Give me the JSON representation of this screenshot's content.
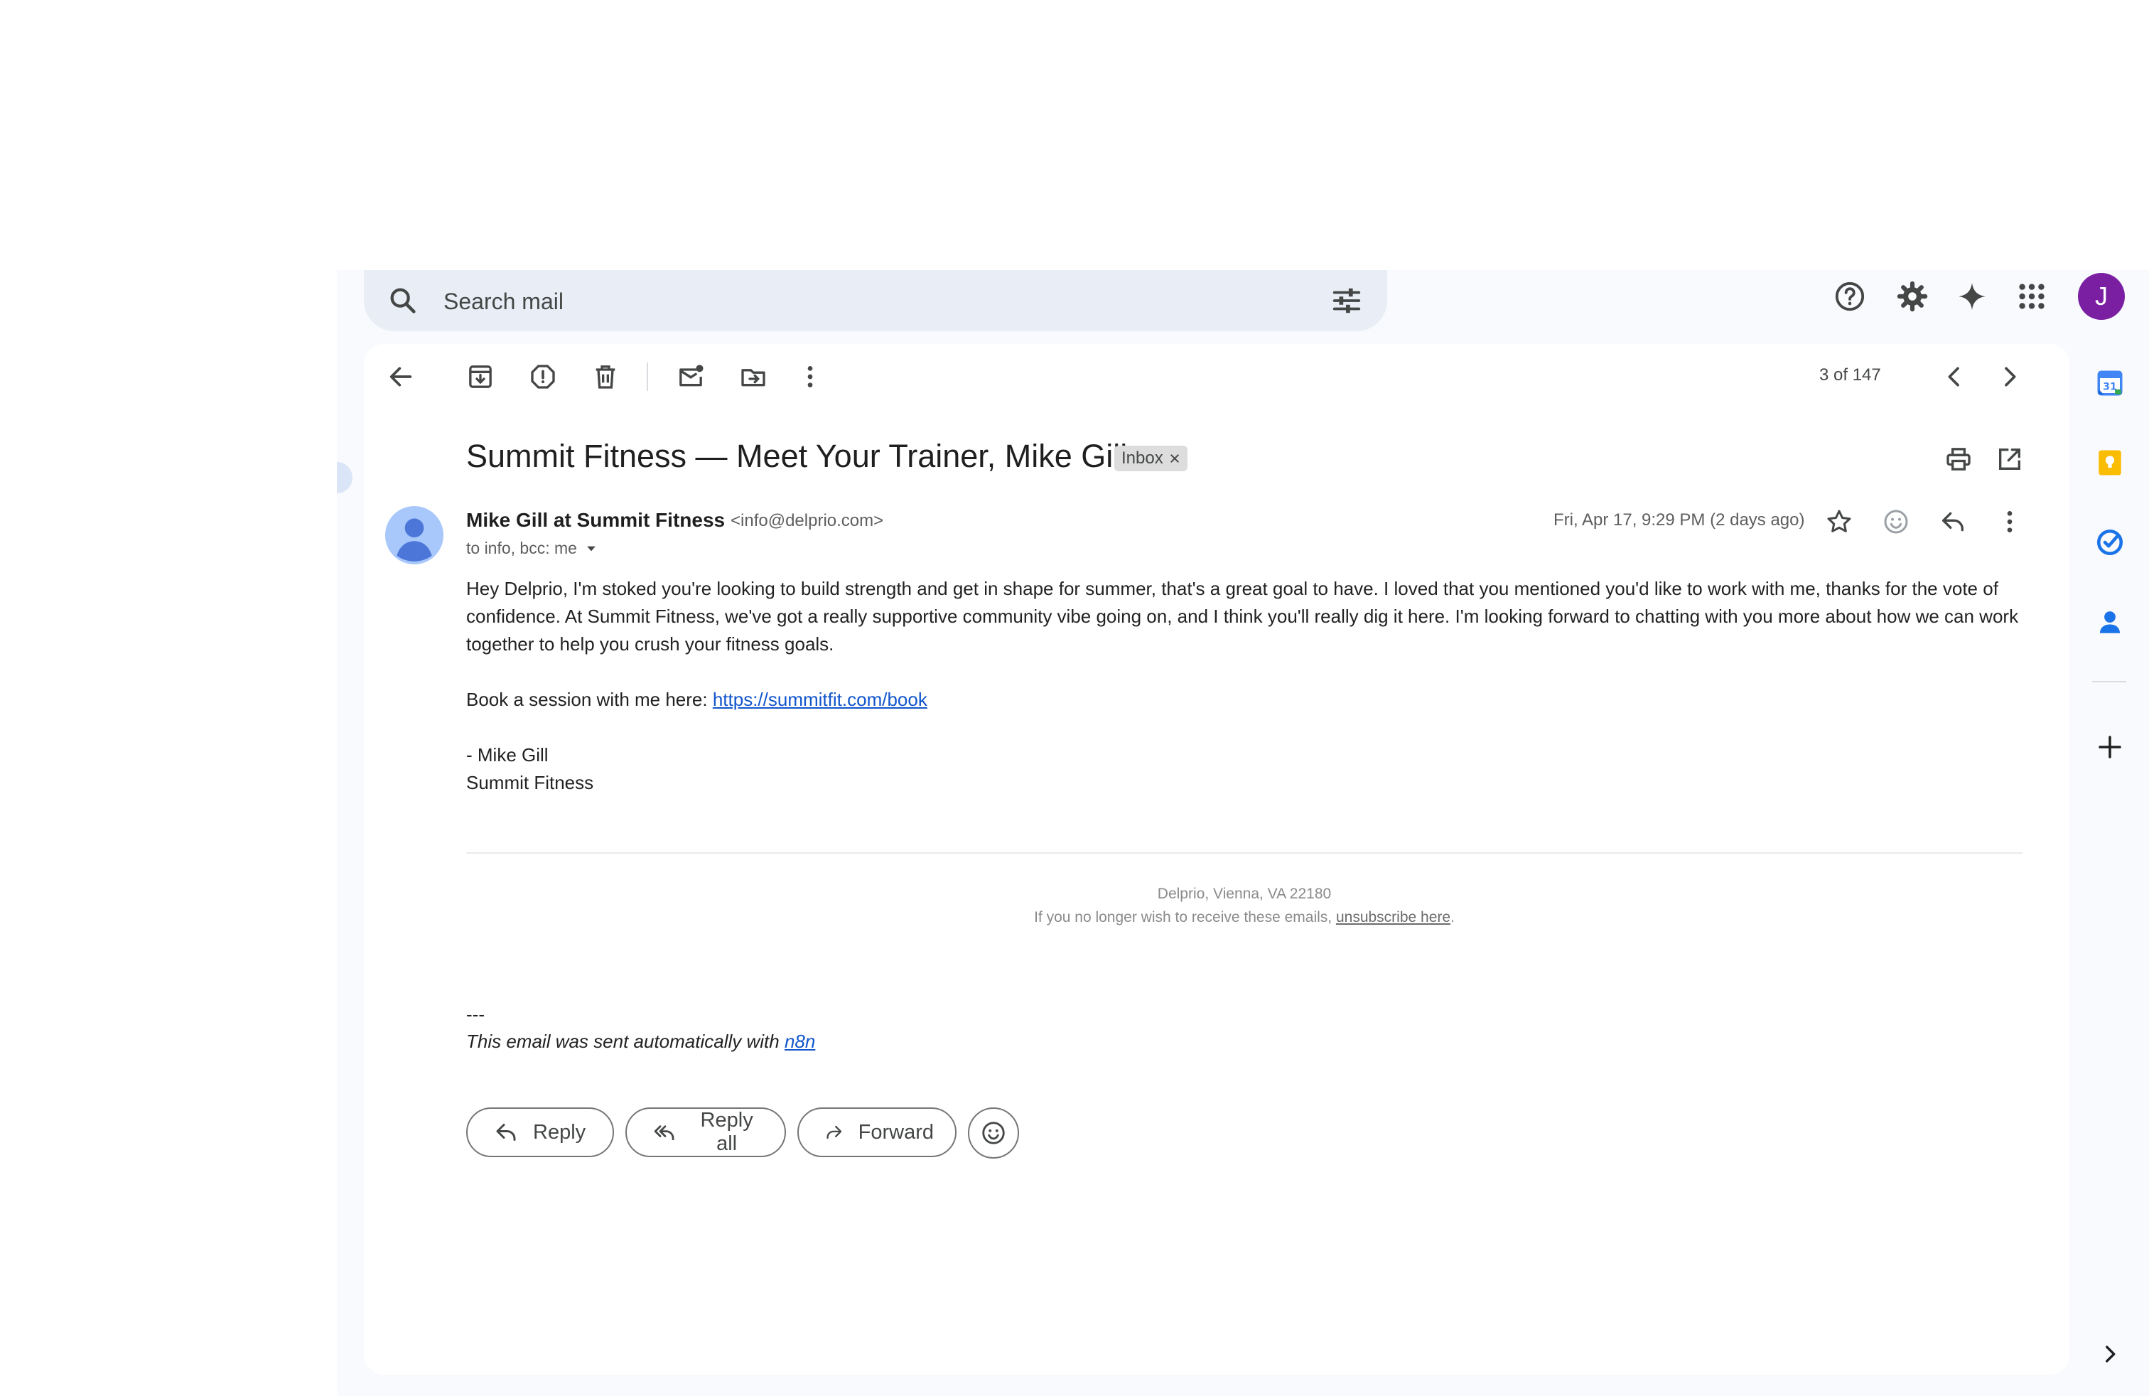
{
  "search": {
    "placeholder": "Search mail"
  },
  "header": {
    "avatar_letter": "J"
  },
  "toolbar": {
    "pager": "3 of 147"
  },
  "email": {
    "subject": "Summit Fitness — Meet Your Trainer, Mike Gill",
    "label": "Inbox",
    "sender_name": "Mike Gill at Summit Fitness",
    "sender_email": "<info@delprio.com>",
    "recipients": "to info, bcc: me",
    "date": "Fri, Apr 17, 9:29 PM (2 days ago)",
    "body_paragraph": "Hey Delprio, I'm stoked you're looking to build strength and get in shape for summer, that's a great goal to have. I loved that you mentioned you'd like to work with me, thanks for the vote of confidence. At Summit Fitness, we've got a really supportive community vibe going on, and I think you'll really dig it here. I'm looking forward to chatting with you more about how we can work together to help you crush your fitness goals.",
    "book_prefix": "Book a session with me here: ",
    "book_link": "https://summitfit.com/book",
    "signature_name": "- Mike Gill",
    "signature_org": "Summit Fitness",
    "footer_address": "Delprio, Vienna, VA 22180",
    "footer_unsub_prefix": "If you no longer wish to receive these emails, ",
    "footer_unsub_link": "unsubscribe here",
    "footer_unsub_suffix": ".",
    "sig_dash": "---",
    "auto_note_prefix": "This email was sent automatically with ",
    "auto_note_link": "n8n"
  },
  "actions": {
    "reply": "Reply",
    "reply_all": "Reply all",
    "forward": "Forward"
  },
  "colors": {
    "accent": "#0b57d0",
    "avatar": "#7b1fa2",
    "link": "#1155cc"
  }
}
